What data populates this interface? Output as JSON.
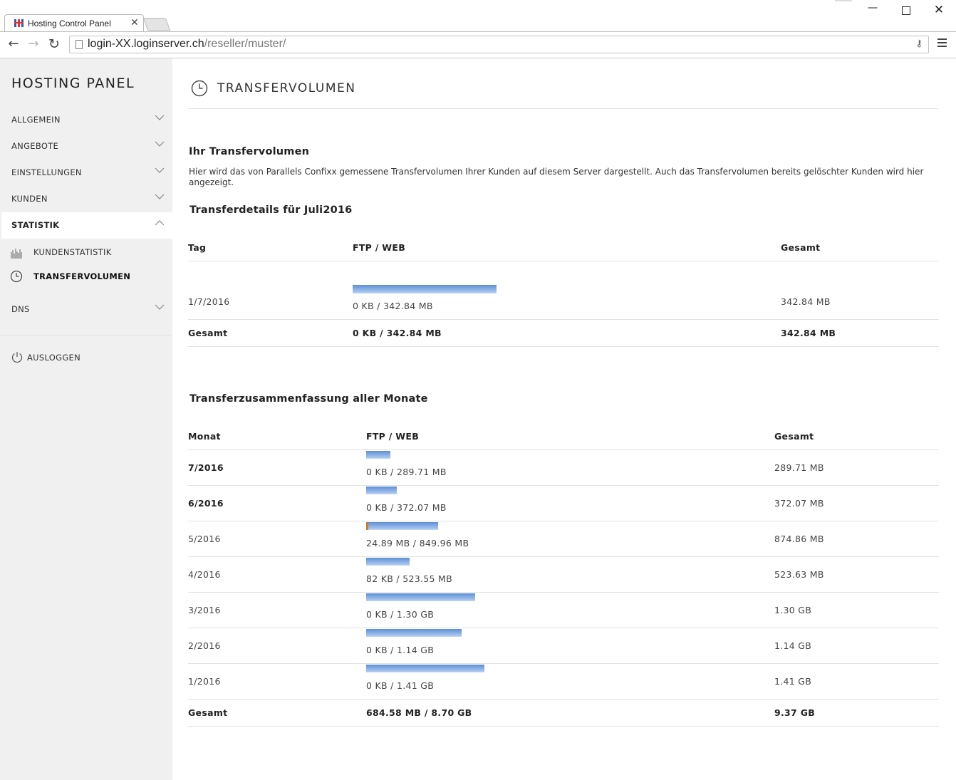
{
  "browser": {
    "tab_title": "Hosting Control Panel",
    "url_host": "login-XX.loginserver.ch",
    "url_path": "/reseller/muster/",
    "icons": [
      "back-arrow-icon",
      "forward-arrow-icon",
      "reload-icon",
      "page-icon",
      "key-icon",
      "menu-icon",
      "close-icon"
    ]
  },
  "sidebar": {
    "brand": "HOSTING PANEL",
    "items": {
      "allgemein": "ALLGEMEIN",
      "angebote": "ANGEBOTE",
      "einstellungen": "EINSTELLUNGEN",
      "kunden": "KUNDEN",
      "statistik": "STATISTIK",
      "dns": "DNS"
    },
    "sub_items": {
      "kundenstatistik": "KUNDENSTATISTIK",
      "transfervolumen": "TRANSFERVOLUMEN"
    },
    "logout": "AUSLOGGEN"
  },
  "main": {
    "title": "TRANSFERVOLUMEN",
    "section_title": "Ihr Transfervolumen",
    "intro": "Hier wird das von Parallels Confixx gemessene Transfervolumen Ihrer Kunden auf diesem Server dargestellt. Auch das Transfervolumen bereits gelöschter Kunden wird hier angezeigt.",
    "details": {
      "heading": "Transferdetails für Juli2016",
      "col_day": "Tag",
      "col_ftpweb": "FTP / WEB",
      "col_total": "Gesamt",
      "row": {
        "day": "1/7/2016",
        "ftpweb": "0 KB / 342.84 MB",
        "total": "342.84 MB",
        "ftp_share": 0,
        "fill": 0.24
      },
      "sum_label": "Gesamt",
      "sum_ftpweb": "0 KB / 342.84 MB",
      "sum_total": "342.84 MB"
    },
    "summary": {
      "heading": "Transferzusammenfassung aller Monate",
      "col_month": "Monat",
      "col_ftpweb": "FTP / WEB",
      "col_total": "Gesamt",
      "rows": [
        {
          "month": "7/2016",
          "ftpweb": "0 KB / 289.71 MB",
          "total": "289.71 MB",
          "bold": true,
          "fill": 0.204,
          "ftp_share": 0
        },
        {
          "month": "6/2016",
          "ftpweb": "0 KB / 372.07 MB",
          "total": "372.07 MB",
          "bold": true,
          "fill": 0.262,
          "ftp_share": 0
        },
        {
          "month": "5/2016",
          "ftpweb": "24.89 MB / 849.96 MB",
          "total": "874.86 MB",
          "bold": false,
          "fill": 0.608,
          "ftp_share": 0.028
        },
        {
          "month": "4/2016",
          "ftpweb": "82 KB / 523.55 MB",
          "total": "523.63 MB",
          "bold": false,
          "fill": 0.366,
          "ftp_share": 0
        },
        {
          "month": "3/2016",
          "ftpweb": "0 KB / 1.30 GB",
          "total": "1.30 GB",
          "bold": false,
          "fill": 0.922,
          "ftp_share": 0
        },
        {
          "month": "2/2016",
          "ftpweb": "0 KB / 1.14 GB",
          "total": "1.14 GB",
          "bold": false,
          "fill": 0.808,
          "ftp_share": 0
        },
        {
          "month": "1/2016",
          "ftpweb": "0 KB / 1.41 GB",
          "total": "1.41 GB",
          "bold": false,
          "fill": 1.0,
          "ftp_share": 0
        }
      ],
      "sum_label": "Gesamt",
      "sum_ftpweb": "684.58 MB / 8.70 GB",
      "sum_total": "9.37 GB"
    }
  },
  "colors": {
    "bar_web": "#6f9de0",
    "bar_ftp": "#d07a2a",
    "sidebar_bg": "#f0f0f0"
  }
}
